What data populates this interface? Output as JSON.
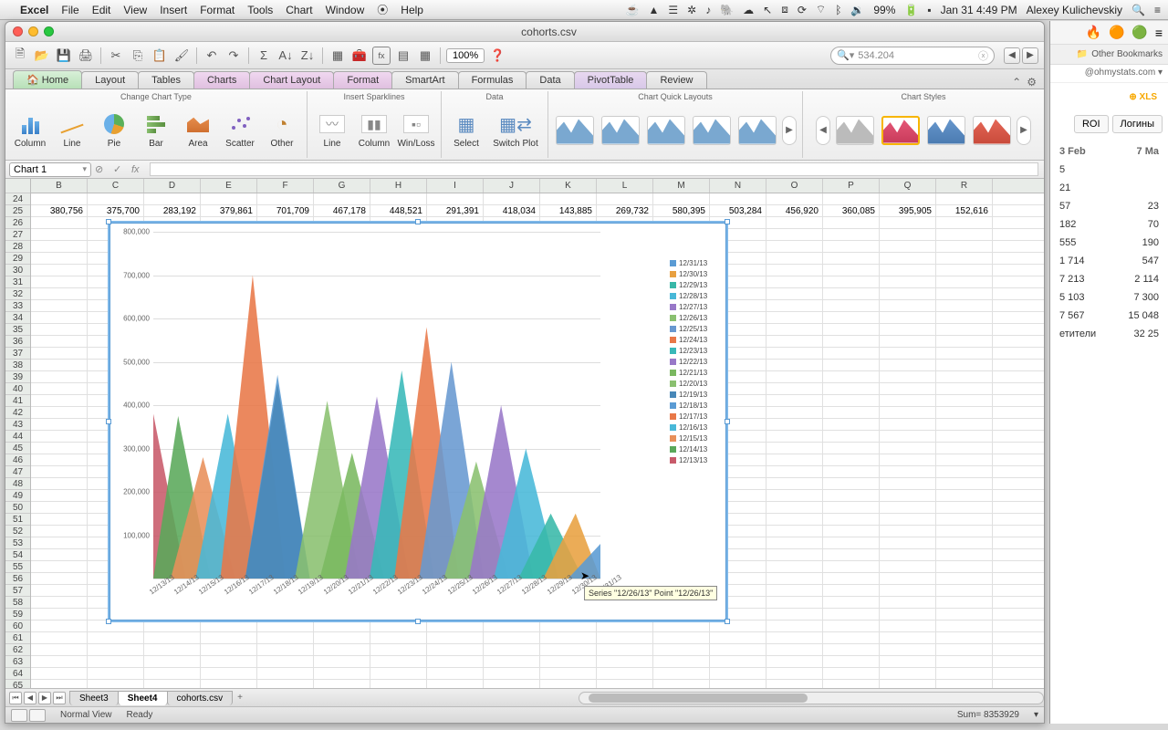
{
  "menubar": {
    "app": "Excel",
    "items": [
      "File",
      "Edit",
      "View",
      "Insert",
      "Format",
      "Tools",
      "Chart",
      "Window",
      "Help"
    ],
    "battery": "99%",
    "datetime": "Jan 31  4:49 PM",
    "user": "Alexey Kulichevskiy"
  },
  "window": {
    "title": "cohorts.csv"
  },
  "toolbar": {
    "zoom": "100%",
    "search_placeholder": "534.204"
  },
  "ribbon": {
    "tabs": [
      "Home",
      "Layout",
      "Tables",
      "Charts",
      "Chart Layout",
      "Format",
      "SmartArt",
      "Formulas",
      "Data",
      "PivotTable",
      "Review"
    ],
    "selected": "Charts",
    "groups": {
      "chart_type": {
        "label": "Change Chart Type",
        "buttons": [
          "Column",
          "Line",
          "Pie",
          "Bar",
          "Area",
          "Scatter",
          "Other"
        ]
      },
      "sparklines": {
        "label": "Insert Sparklines",
        "buttons": [
          "Line",
          "Column",
          "Win/Loss"
        ]
      },
      "data": {
        "label": "Data",
        "buttons": [
          "Select",
          "Switch Plot"
        ]
      },
      "quick_layouts": {
        "label": "Chart Quick Layouts"
      },
      "chart_styles": {
        "label": "Chart Styles"
      }
    }
  },
  "namebox": {
    "value": "Chart 1"
  },
  "columns": [
    "B",
    "C",
    "D",
    "E",
    "F",
    "G",
    "H",
    "I",
    "J",
    "K",
    "L",
    "M",
    "N",
    "O",
    "P",
    "Q",
    "R"
  ],
  "row_start": 24,
  "row_end": 66,
  "row25": [
    "380,756",
    "375,700",
    "283,192",
    "379,861",
    "701,709",
    "467,178",
    "448,521",
    "291,391",
    "418,034",
    "143,885",
    "269,732",
    "580,395",
    "503,284",
    "456,920",
    "360,085",
    "395,905",
    "152,616"
  ],
  "chart_tooltip": "Series \"12/26/13\" Point \"12/26/13\"",
  "sheets": {
    "tabs": [
      "Sheet3",
      "Sheet4",
      "cohorts.csv"
    ],
    "active": "Sheet4"
  },
  "status": {
    "view": "Normal View",
    "state": "Ready",
    "sum": "Sum= 8353929"
  },
  "browser": {
    "bookmarks_label": "Other Bookmarks",
    "url_fragment": "@ohmystats.com ▾",
    "xls": "⊕ XLS",
    "tabs": [
      "ROI",
      "Логины"
    ],
    "headers": [
      "3 Feb",
      "7 Ma"
    ],
    "rows": [
      [
        "5",
        ""
      ],
      [
        "21",
        ""
      ],
      [
        "57",
        "23"
      ],
      [
        "182",
        "70"
      ],
      [
        "555",
        "190"
      ],
      [
        "1 714",
        "547"
      ],
      [
        "7 213",
        "2 114"
      ],
      [
        "5 103",
        "7 300"
      ],
      [
        "7 567",
        "15 048"
      ],
      [
        "етители",
        "32 25"
      ]
    ]
  },
  "chart_data": {
    "type": "area",
    "title": "",
    "ylabel": "",
    "ylim": [
      0,
      800000
    ],
    "yticks": [
      0,
      100000,
      200000,
      300000,
      400000,
      500000,
      600000,
      700000,
      800000
    ],
    "ytick_labels": [
      "",
      "100,000",
      "200,000",
      "300,000",
      "400,000",
      "500,000",
      "600,000",
      "700,000",
      "800,000"
    ],
    "categories": [
      "12/13/13",
      "12/14/13",
      "12/15/13",
      "12/16/13",
      "12/17/13",
      "12/18/13",
      "12/19/13",
      "12/20/13",
      "12/21/13",
      "12/22/13",
      "12/23/13",
      "12/24/13",
      "12/25/13",
      "12/26/13",
      "12/27/13",
      "12/28/13",
      "12/29/13",
      "12/30/13",
      "12/31/13"
    ],
    "legend_order": [
      "12/31/13",
      "12/30/13",
      "12/29/13",
      "12/28/13",
      "12/27/13",
      "12/26/13",
      "12/25/13",
      "12/24/13",
      "12/23/13",
      "12/22/13",
      "12/21/13",
      "12/20/13",
      "12/19/13",
      "12/18/13",
      "12/17/13",
      "12/16/13",
      "12/15/13",
      "12/14/13",
      "12/13/13"
    ],
    "series": [
      {
        "name": "12/13/13",
        "color": "#c85a6a",
        "peak_index": 0,
        "peak_value": 380000
      },
      {
        "name": "12/14/13",
        "color": "#5aa85a",
        "peak_index": 1,
        "peak_value": 375000
      },
      {
        "name": "12/15/13",
        "color": "#e8905a",
        "peak_index": 2,
        "peak_value": 280000
      },
      {
        "name": "12/16/13",
        "color": "#48b8d8",
        "peak_index": 3,
        "peak_value": 380000
      },
      {
        "name": "12/17/13",
        "color": "#e87848",
        "peak_index": 4,
        "peak_value": 700000
      },
      {
        "name": "12/18/13",
        "color": "#5a9bd4",
        "peak_index": 5,
        "peak_value": 470000
      },
      {
        "name": "12/19/13",
        "color": "#4888b8",
        "peak_index": 5,
        "peak_value": 450000
      },
      {
        "name": "12/20/13",
        "color": "#8ac070",
        "peak_index": 7,
        "peak_value": 410000
      },
      {
        "name": "12/21/13",
        "color": "#7ab860",
        "peak_index": 8,
        "peak_value": 290000
      },
      {
        "name": "12/22/13",
        "color": "#9878c8",
        "peak_index": 9,
        "peak_value": 420000
      },
      {
        "name": "12/23/13",
        "color": "#38b8b8",
        "peak_index": 10,
        "peak_value": 480000
      },
      {
        "name": "12/24/13",
        "color": "#e87848",
        "peak_index": 11,
        "peak_value": 580000
      },
      {
        "name": "12/25/13",
        "color": "#6898d0",
        "peak_index": 12,
        "peak_value": 500000
      },
      {
        "name": "12/26/13",
        "color": "#8ac070",
        "peak_index": 13,
        "peak_value": 270000
      },
      {
        "name": "12/27/13",
        "color": "#9878c8",
        "peak_index": 14,
        "peak_value": 400000
      },
      {
        "name": "12/28/13",
        "color": "#48b8d8",
        "peak_index": 15,
        "peak_value": 300000
      },
      {
        "name": "12/29/13",
        "color": "#38b8a8",
        "peak_index": 16,
        "peak_value": 150000
      },
      {
        "name": "12/30/13",
        "color": "#e8a040",
        "peak_index": 17,
        "peak_value": 150000
      },
      {
        "name": "12/31/13",
        "color": "#5a9bd4",
        "peak_index": 18,
        "peak_value": 80000
      }
    ]
  }
}
